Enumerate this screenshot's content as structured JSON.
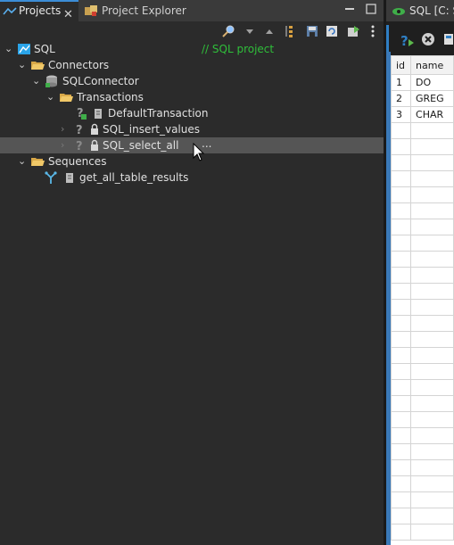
{
  "tabs": [
    {
      "label": "Projects",
      "active": true
    },
    {
      "label": "Project Explorer",
      "active": false
    }
  ],
  "toolbar_icons": [
    "search-icon",
    "chevron-down-icon",
    "chevron-up-icon",
    "collapse-icon",
    "save-icon",
    "refresh-icon",
    "run-icon",
    "more-icon"
  ],
  "tree": {
    "root": {
      "label": "SQL",
      "comment": "// SQL project"
    },
    "connectors": {
      "label": "Connectors"
    },
    "connector": {
      "label": "SQLConnector"
    },
    "transactions": {
      "label": "Transactions"
    },
    "default_transaction": {
      "label": "DefaultTransaction"
    },
    "insert_values": {
      "label": "SQL_insert_values"
    },
    "select_all": {
      "label": "SQL_select_all",
      "ellipsis": "..."
    },
    "sequences": {
      "label": "Sequences"
    },
    "sequence_item": {
      "label": "get_all_table_results"
    }
  },
  "right_panel": {
    "tab_label": "SQL [C: Se",
    "columns": [
      "id",
      "name"
    ],
    "rows": [
      [
        "1",
        "DO"
      ],
      [
        "2",
        "GREG"
      ],
      [
        "3",
        "CHAR"
      ]
    ]
  },
  "colors": {
    "accent": "#3c8dd6",
    "comment": "#2fbf3a",
    "selection": "#555555"
  }
}
